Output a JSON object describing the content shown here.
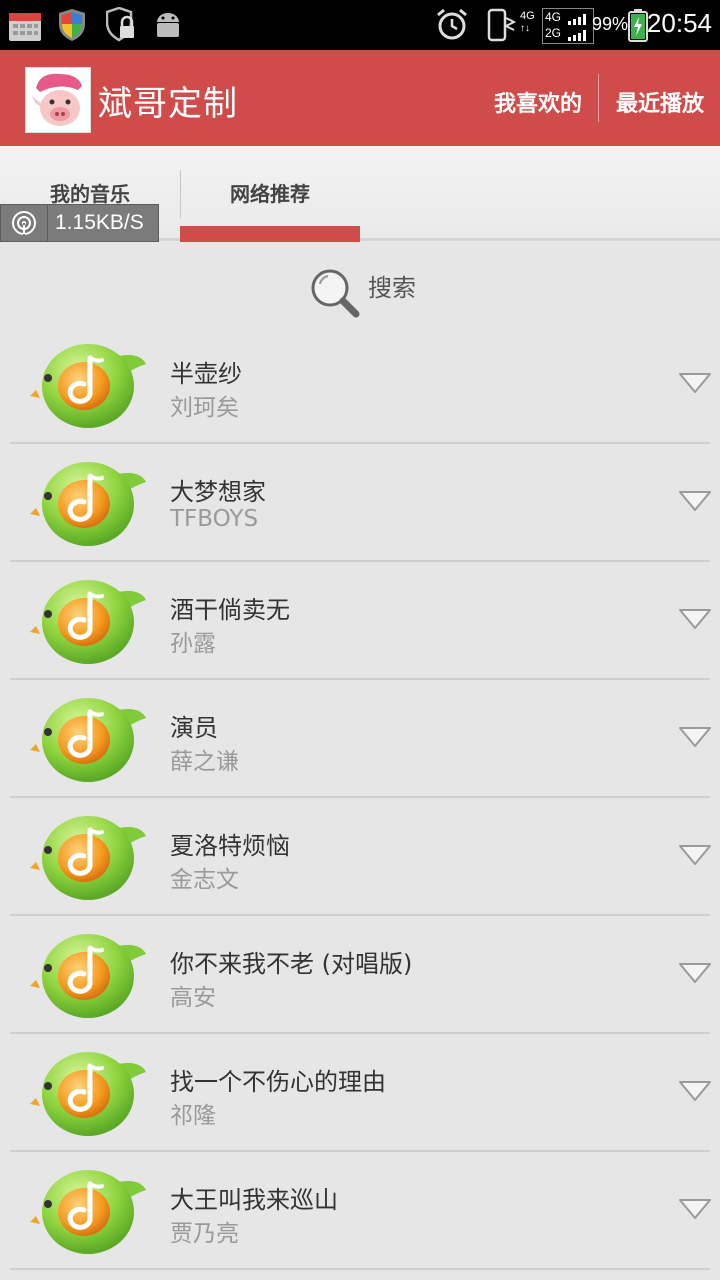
{
  "status_bar": {
    "network_label_top": "4G",
    "network_label_bottom": "2G",
    "battery_percent": "99%",
    "time": "20:54"
  },
  "app_bar": {
    "title": "斌哥定制",
    "favorites_label": "我喜欢的",
    "recent_label": "最近播放",
    "accent_color": "#cf4c4a"
  },
  "tabs": [
    {
      "label": "我的音乐",
      "active": false
    },
    {
      "label": "网络推荐",
      "active": true
    }
  ],
  "speed_indicator": "1.15KB/S",
  "search": {
    "label": "搜索"
  },
  "songs": [
    {
      "title": "半壶纱",
      "artist": "刘珂矣"
    },
    {
      "title": "大梦想家",
      "artist": "TFBOYS"
    },
    {
      "title": "酒干倘卖无",
      "artist": "孙露"
    },
    {
      "title": "演员",
      "artist": "薛之谦"
    },
    {
      "title": "夏洛特烦恼",
      "artist": "金志文"
    },
    {
      "title": "你不来我不老 (对唱版)",
      "artist": "高安"
    },
    {
      "title": "找一个不伤心的理由",
      "artist": "祁隆"
    },
    {
      "title": "大王叫我来巡山",
      "artist": "贾乃亮"
    }
  ]
}
